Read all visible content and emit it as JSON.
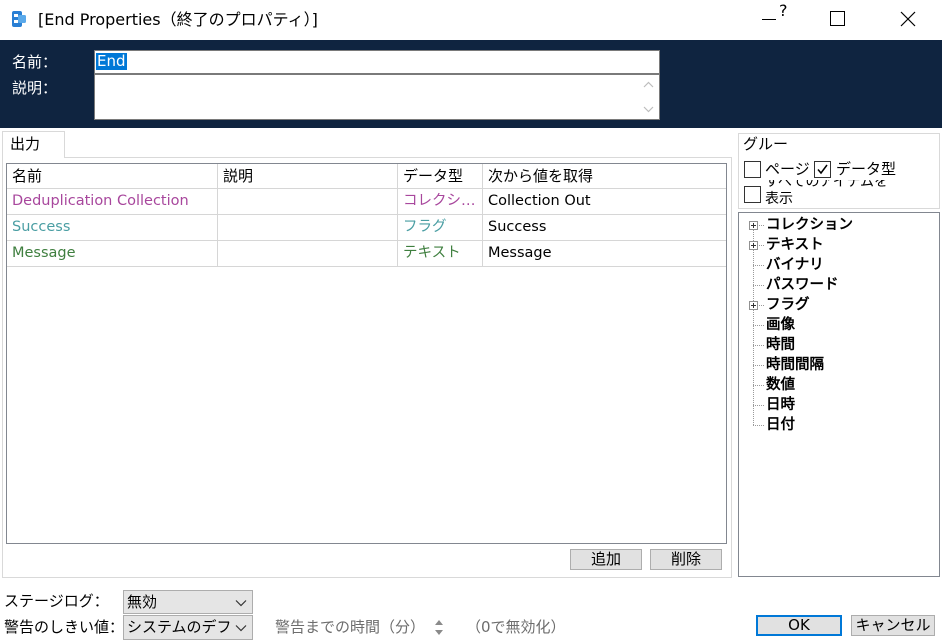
{
  "window": {
    "title": "[End Properties（終了のプロパティ）]",
    "help": "?"
  },
  "header": {
    "name_label": "名前：",
    "name_value": "End",
    "description_label": "説明：",
    "description_value": ""
  },
  "tabs": [
    {
      "label": "出力",
      "active": true
    }
  ],
  "table": {
    "columns": [
      "名前",
      "説明",
      "データ型",
      "次から値を取得"
    ],
    "rows": [
      {
        "name": "Deduplication Collection",
        "description": "",
        "data_type": "コレクシ…",
        "get_value_from": "Collection Out",
        "color": "#a8479d"
      },
      {
        "name": "Success",
        "description": "",
        "data_type": "フラグ",
        "get_value_from": "Success",
        "color": "#4a9ea3"
      },
      {
        "name": "Message",
        "description": "",
        "data_type": "テキスト",
        "get_value_from": "Message",
        "color": "#3f7f3f"
      }
    ],
    "add_label": "追加",
    "delete_label": "削除"
  },
  "group": {
    "title": "グルー",
    "options": [
      {
        "label": "ページ",
        "checked": false
      },
      {
        "label": "データ型",
        "checked": true
      },
      {
        "label": "すべてのアイテムを表示",
        "checked": false
      }
    ]
  },
  "tree": {
    "items": [
      {
        "label": "コレクション",
        "expandable": true
      },
      {
        "label": "テキスト",
        "expandable": true
      },
      {
        "label": "バイナリ",
        "expandable": false
      },
      {
        "label": "パスワード",
        "expandable": false
      },
      {
        "label": "フラグ",
        "expandable": true
      },
      {
        "label": "画像",
        "expandable": false
      },
      {
        "label": "時間",
        "expandable": false
      },
      {
        "label": "時間間隔",
        "expandable": false
      },
      {
        "label": "数値",
        "expandable": false
      },
      {
        "label": "日時",
        "expandable": false
      },
      {
        "label": "日付",
        "expandable": false
      }
    ]
  },
  "footer": {
    "stage_log_label": "ステージログ：",
    "stage_log_value": "無効",
    "warning_threshold_label": "警告のしきい値：",
    "warning_threshold_value": "システムのデフォルト",
    "warning_time_label": "警告までの時間（分）",
    "disable_hint": "（0で無効化）",
    "ok_label": "OK",
    "cancel_label": "キャンセル"
  },
  "colors": {
    "header_band": "#0f2440",
    "accent": "#0078d7"
  }
}
